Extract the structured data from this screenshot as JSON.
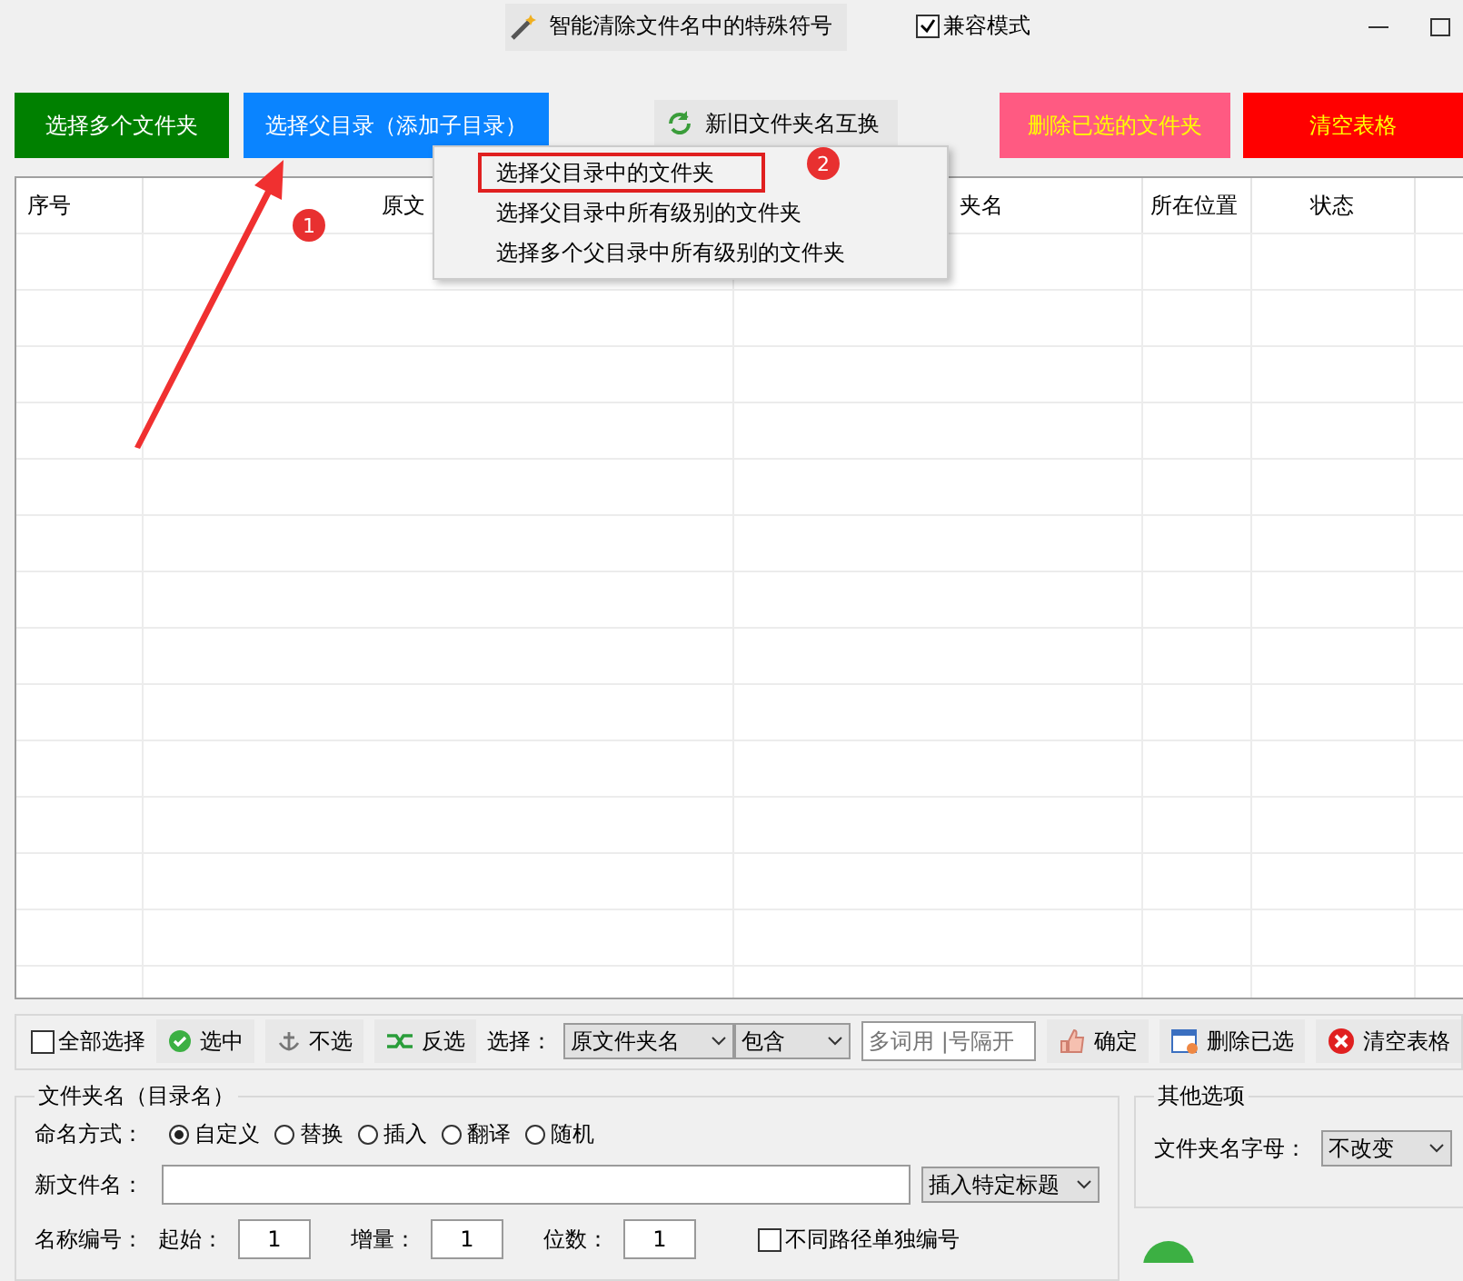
{
  "window": {
    "title": "智能清除文件名中的特殊符号",
    "compat_mode": {
      "label": "兼容模式",
      "checked": true
    }
  },
  "top_buttons": [
    {
      "label": "选择多个文件夹",
      "kind": "primary",
      "color": "#008000"
    },
    {
      "label": "选择父目录（添加子目录）",
      "kind": "primary",
      "color": "#0a84ff"
    },
    {
      "label": "新旧文件夹名互换",
      "kind": "icon"
    },
    {
      "label": "删除已选的文件夹",
      "kind": "danger",
      "color": "#ff5a82"
    },
    {
      "label": "清空表格",
      "kind": "danger",
      "color": "#ff0000"
    }
  ],
  "context_menu": {
    "items": [
      {
        "label": "选择父目录中的文件夹",
        "selected": true
      },
      {
        "label": "选择父目录中所有级别的文件夹",
        "selected": false
      },
      {
        "label": "选择多个父目录中所有级别的文件夹",
        "selected": false
      }
    ]
  },
  "annotations": {
    "badges": [
      "1",
      "2"
    ]
  },
  "table": {
    "columns": [
      "序号",
      "原文",
      "夹名",
      "所在位置",
      "状态"
    ]
  },
  "toolbar": {
    "select_all": {
      "label": "全部选择",
      "checked": false
    },
    "buttons": [
      {
        "label": "选中",
        "kind": "check"
      },
      {
        "label": "不选",
        "kind": "anchor"
      },
      {
        "label": "反选",
        "kind": "shuffle"
      }
    ],
    "select_label": "选择：",
    "field_dropdown": "原文件夹名",
    "match_dropdown": "包含",
    "filter_placeholder": "多词用 |号隔开",
    "actions": [
      {
        "label": "确定",
        "kind": "thumb"
      },
      {
        "label": "删除已选",
        "kind": "window"
      },
      {
        "label": "清空表格",
        "kind": "clear"
      }
    ]
  },
  "naming": {
    "title": "文件夹名（目录名）",
    "mode_label": "命名方式：",
    "modes": [
      {
        "label": "自定义",
        "selected": true
      },
      {
        "label": "替换",
        "selected": false
      },
      {
        "label": "插入",
        "selected": false
      },
      {
        "label": "翻译",
        "selected": false
      },
      {
        "label": "随机",
        "selected": false
      }
    ],
    "new_name_label": "新文件名：",
    "insert_dropdown": "插入特定标题",
    "numbering_label": "名称编号：",
    "numbering": [
      {
        "label": "起始：",
        "value": "1"
      },
      {
        "label": "增量：",
        "value": "1"
      },
      {
        "label": "位数：",
        "value": "1"
      }
    ],
    "separate": {
      "label": "不同路径单独编号",
      "checked": false
    }
  },
  "other": {
    "title": "其他选项",
    "case_label": "文件夹名字母：",
    "case_dropdown": "不改变"
  }
}
